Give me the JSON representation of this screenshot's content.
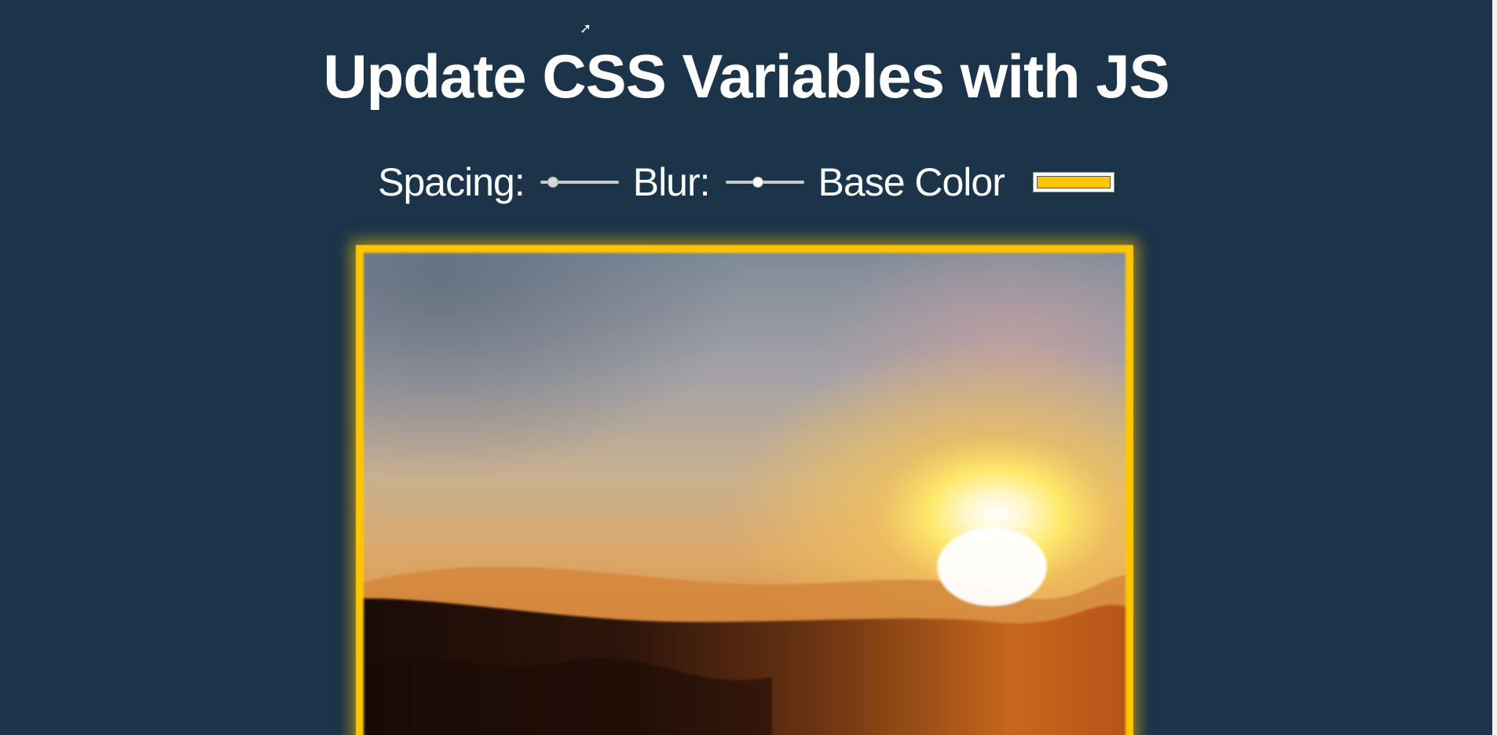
{
  "page": {
    "title": "Update CSS Variables with JS"
  },
  "controls": {
    "spacing_label": "Spacing:",
    "spacing_value": 0.1,
    "blur_label": "Blur:",
    "blur_value": 0.4,
    "base_color_label": "Base Color",
    "base_color_value": "#ffc600"
  },
  "image": {
    "subject": "sunset landscape",
    "icon": "image-icon"
  },
  "colors": {
    "background": "#1b3449",
    "base": "#ffc600",
    "text": "#ffffff"
  }
}
